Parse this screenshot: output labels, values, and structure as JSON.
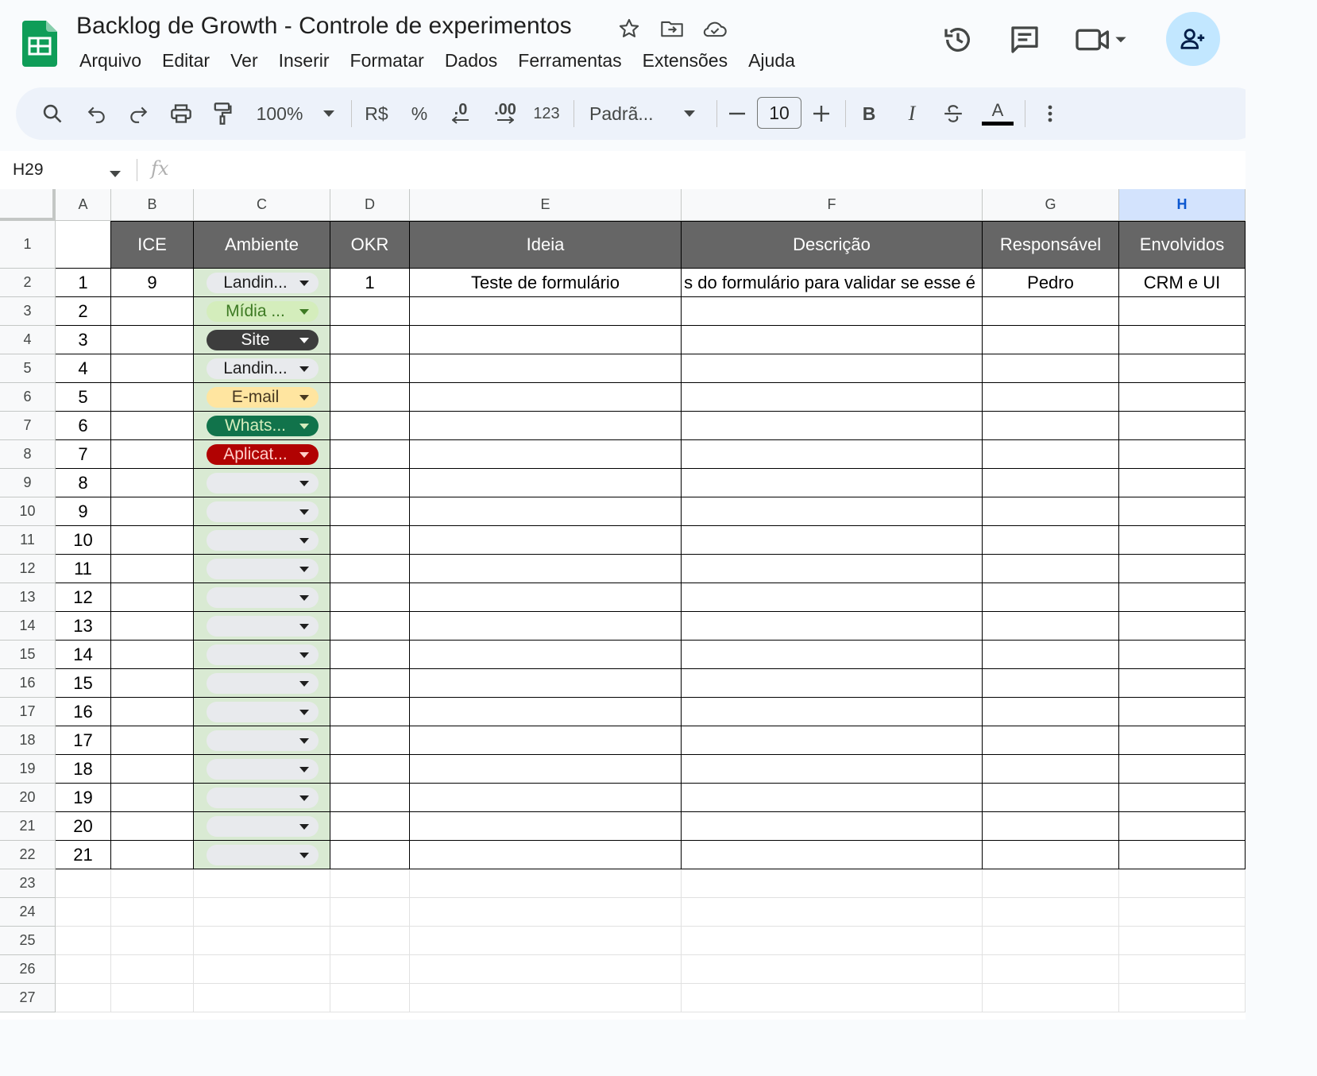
{
  "app": {
    "title": "Backlog de Growth - Controle de experimentos",
    "menu": [
      "Arquivo",
      "Editar",
      "Ver",
      "Inserir",
      "Formatar",
      "Dados",
      "Ferramentas",
      "Extensões",
      "Ajuda"
    ]
  },
  "toolbar": {
    "zoom": "100%",
    "currency": "R$",
    "percent": "%",
    "dec_decrease": ".0",
    "dec_increase": ".00",
    "number_format": "123",
    "font": "Padrã...",
    "font_size": "10",
    "bold": "B",
    "italic": "I",
    "text_color_letter": "A",
    "text_color": "#000000"
  },
  "formula_bar": {
    "cell_ref": "H29",
    "fx": "fx",
    "value": ""
  },
  "columns": [
    "A",
    "B",
    "C",
    "D",
    "E",
    "F",
    "G",
    "H"
  ],
  "selected_column": "H",
  "rows": [
    "1",
    "2",
    "3",
    "4",
    "5",
    "6",
    "7",
    "8",
    "9",
    "10",
    "11",
    "12",
    "13",
    "14",
    "15",
    "16",
    "17",
    "18",
    "19",
    "20",
    "21",
    "22",
    "23",
    "24",
    "25",
    "26",
    "27"
  ],
  "header_row": [
    "",
    "ICE",
    "Ambiente",
    "OKR",
    "Ideia",
    "Descrição",
    "Responsável",
    "Envolvidos"
  ],
  "data_row": {
    "a": "1",
    "b": "9",
    "d": "1",
    "e": "Teste de formulário",
    "f": "s do formulário para validar se esse é",
    "g": "Pedro",
    "h": "CRM e UI"
  },
  "column_a": [
    "2",
    "3",
    "4",
    "5",
    "6",
    "7",
    "8",
    "9",
    "10",
    "11",
    "12",
    "13",
    "14",
    "15",
    "16",
    "17",
    "18",
    "19",
    "20",
    "21"
  ],
  "ambiente_chips": [
    {
      "label": "Landin...",
      "bg": "#e8eaed",
      "fg": "#1f1f1f"
    },
    {
      "label": "Mídia ...",
      "bg": "#d4edbc",
      "fg": "#3d7a23"
    },
    {
      "label": "Site",
      "bg": "#3d3d3d",
      "fg": "#ffffff"
    },
    {
      "label": "Landin...",
      "bg": "#e8eaed",
      "fg": "#1f1f1f"
    },
    {
      "label": "E-mail",
      "bg": "#ffe5a0",
      "fg": "#473821"
    },
    {
      "label": "Whats...",
      "bg": "#11734b",
      "fg": "#d4edbc"
    },
    {
      "label": "Aplicat...",
      "bg": "#b10202",
      "fg": "#ffcfc9"
    },
    {
      "label": "",
      "bg": "#e8eaed",
      "fg": "#1f1f1f"
    },
    {
      "label": "",
      "bg": "#e8eaed",
      "fg": "#1f1f1f"
    },
    {
      "label": "",
      "bg": "#e8eaed",
      "fg": "#1f1f1f"
    },
    {
      "label": "",
      "bg": "#e8eaed",
      "fg": "#1f1f1f"
    },
    {
      "label": "",
      "bg": "#e8eaed",
      "fg": "#1f1f1f"
    },
    {
      "label": "",
      "bg": "#e8eaed",
      "fg": "#1f1f1f"
    },
    {
      "label": "",
      "bg": "#e8eaed",
      "fg": "#1f1f1f"
    },
    {
      "label": "",
      "bg": "#e8eaed",
      "fg": "#1f1f1f"
    },
    {
      "label": "",
      "bg": "#e8eaed",
      "fg": "#1f1f1f"
    },
    {
      "label": "",
      "bg": "#e8eaed",
      "fg": "#1f1f1f"
    },
    {
      "label": "",
      "bg": "#e8eaed",
      "fg": "#1f1f1f"
    },
    {
      "label": "",
      "bg": "#e8eaed",
      "fg": "#1f1f1f"
    },
    {
      "label": "",
      "bg": "#e8eaed",
      "fg": "#1f1f1f"
    },
    {
      "label": "",
      "bg": "#e8eaed",
      "fg": "#1f1f1f"
    }
  ],
  "colors": {
    "header_fill": "#666666",
    "ambiente_fill": "#d9ead3",
    "selected_col_header": "#d3e3fd",
    "share_button": "#c2e7ff",
    "sheets_green": "#0f9d58"
  }
}
